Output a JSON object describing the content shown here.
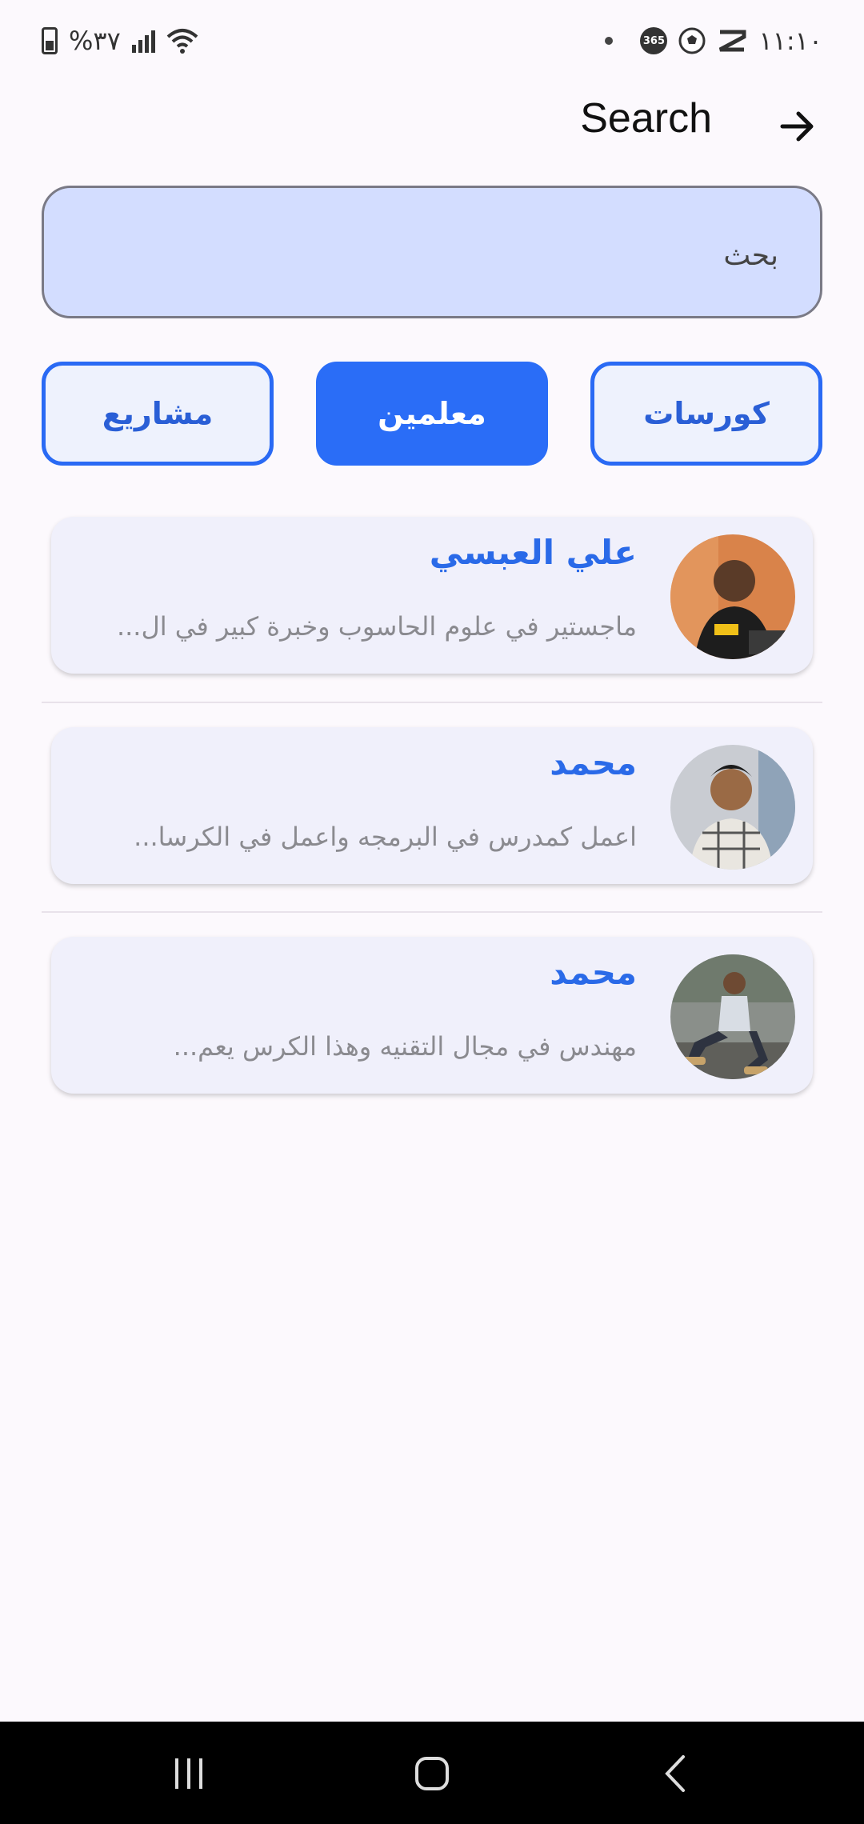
{
  "status_bar": {
    "time": "١١:١٠",
    "battery": "%٣٧",
    "badge_365": "365"
  },
  "header": {
    "title": "Search"
  },
  "search": {
    "placeholder": "بحث"
  },
  "tabs": [
    {
      "label": "كورسات",
      "active": false
    },
    {
      "label": "معلمين",
      "active": true
    },
    {
      "label": "مشاريع",
      "active": false
    }
  ],
  "teachers": [
    {
      "name": "علي العبسي",
      "description": "ماجستير في علوم الحاسوب وخبرة كبير في ال..."
    },
    {
      "name": "محمد",
      "description": "اعمل كمدرس في البرمجه واعمل في الكرسا..."
    },
    {
      "name": "محمد",
      "description": "مهندس في مجال التقنيه وهذا الكرس يعم..."
    }
  ],
  "colors": {
    "accent": "#2a6df7",
    "search_bg": "#d3ddff",
    "card_bg": "#f0f0fb",
    "name_color": "#2a6ae8"
  },
  "icons": {
    "back": "arrow-right-icon",
    "nav_recents": "recents-icon",
    "nav_home": "home-icon",
    "nav_back": "chevron-left-icon"
  }
}
